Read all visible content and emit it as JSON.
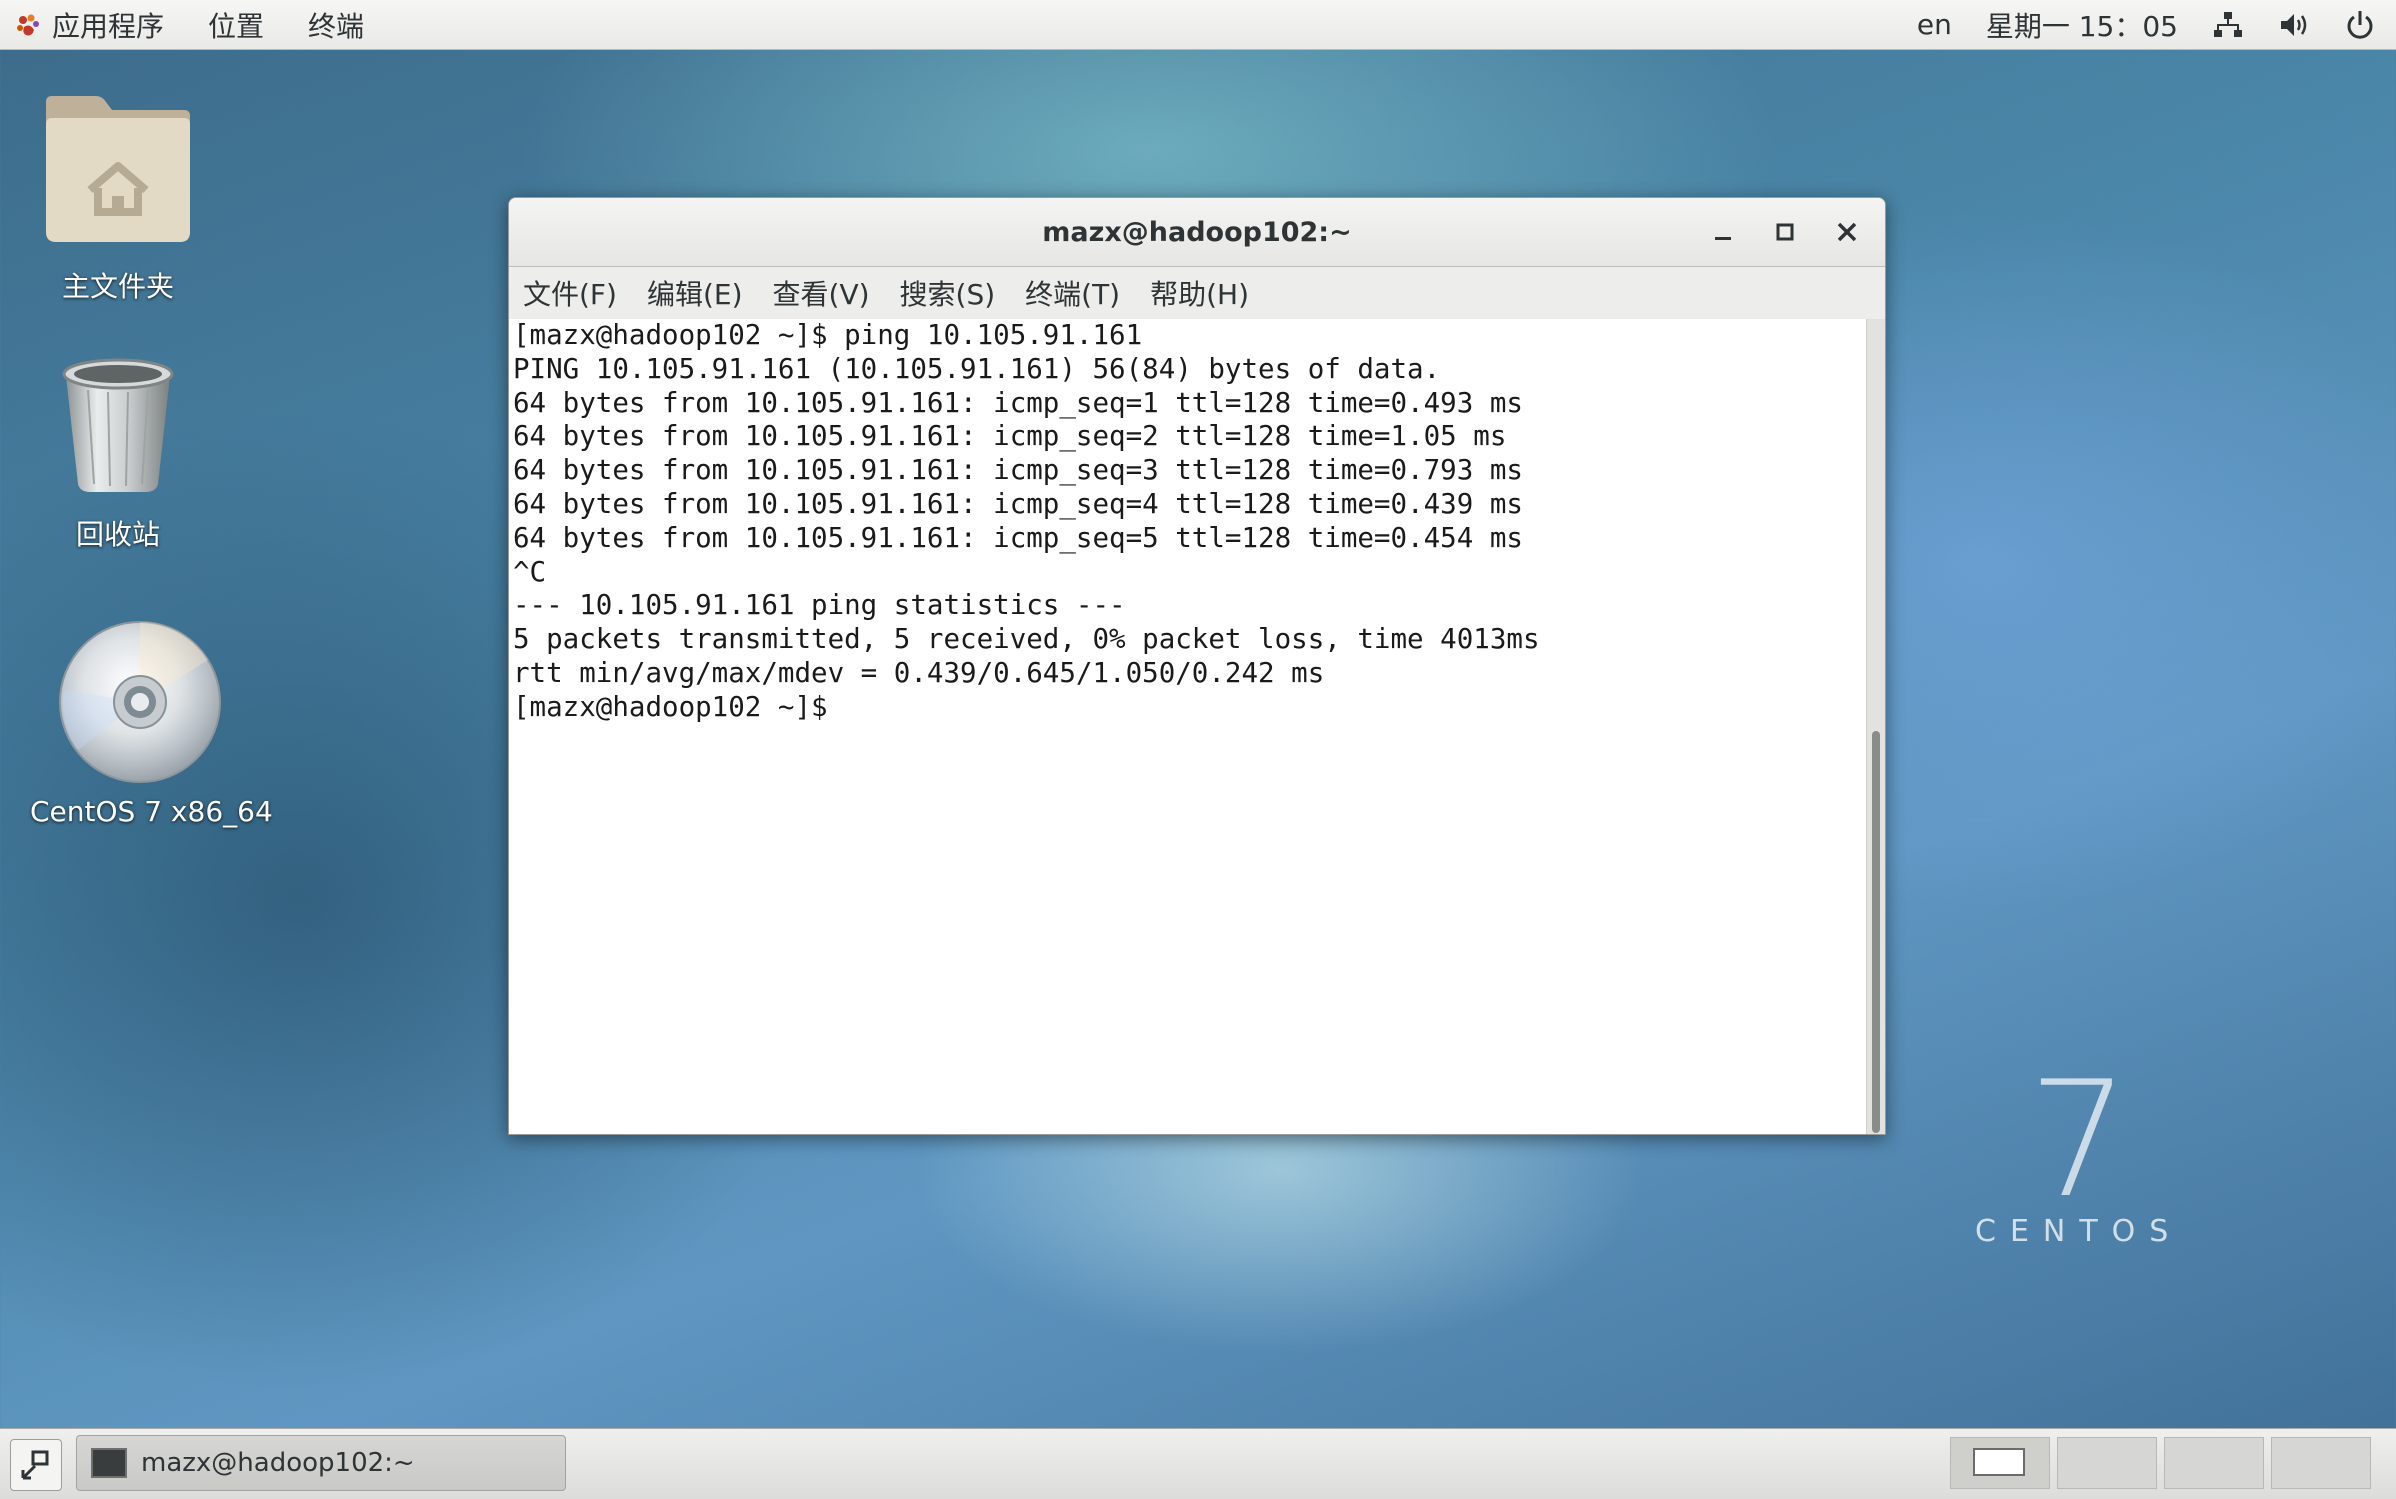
{
  "topbar": {
    "menus": [
      "应用程序",
      "位置",
      "终端"
    ],
    "lang": "en",
    "clock": "星期一 15：05"
  },
  "desktop": {
    "icons": [
      {
        "label": "主文件夹",
        "icon": "home-folder-icon"
      },
      {
        "label": "回收站",
        "icon": "trash-icon"
      },
      {
        "label": "CentOS 7 x86_64",
        "icon": "disc-icon"
      }
    ]
  },
  "window": {
    "title": "mazx@hadoop102:~",
    "menus": [
      "文件(F)",
      "编辑(E)",
      "查看(V)",
      "搜索(S)",
      "终端(T)",
      "帮助(H)"
    ],
    "terminal_lines": [
      "[mazx@hadoop102 ~]$ ping 10.105.91.161",
      "PING 10.105.91.161 (10.105.91.161) 56(84) bytes of data.",
      "64 bytes from 10.105.91.161: icmp_seq=1 ttl=128 time=0.493 ms",
      "64 bytes from 10.105.91.161: icmp_seq=2 ttl=128 time=1.05 ms",
      "64 bytes from 10.105.91.161: icmp_seq=3 ttl=128 time=0.793 ms",
      "64 bytes from 10.105.91.161: icmp_seq=4 ttl=128 time=0.439 ms",
      "64 bytes from 10.105.91.161: icmp_seq=5 ttl=128 time=0.454 ms",
      "^C",
      "--- 10.105.91.161 ping statistics ---",
      "5 packets transmitted, 5 received, 0% packet loss, time 4013ms",
      "rtt min/avg/max/mdev = 0.439/0.645/1.050/0.242 ms",
      "[mazx@hadoop102 ~]$ "
    ]
  },
  "watermark": {
    "number": "7",
    "word": "CENTOS"
  },
  "taskbar": {
    "task_label": "mazx@hadoop102:~",
    "workspace_active": 1
  }
}
